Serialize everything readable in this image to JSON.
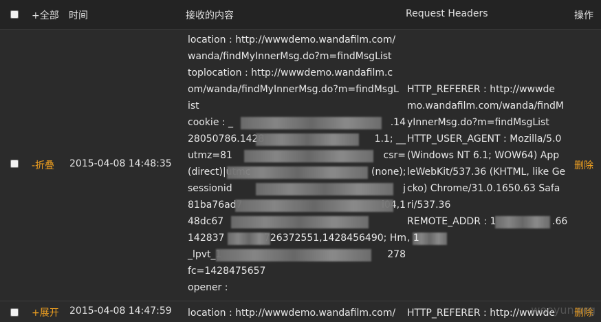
{
  "header": {
    "select_all_label": "+全部",
    "time_label": "时间",
    "content_label": "接收的内容",
    "headers_label": "Request Headers",
    "action_label": "操作"
  },
  "rows": [
    {
      "toggle": "-折叠",
      "time": "2015-04-08 14:48:35",
      "content_lines": [
        "location : http://wwwdemo.wandafilm.com/",
        "wanda/findMyInnerMsg.do?m=findMsgList",
        "toplocation : http://wwwdemo.wandafilm.c",
        "om/wanda/findMyInnerMsg.do?m=findMsgL",
        "ist",
        "cookie : _",
        "28050786.1428",
        "utmz=81",
        "(direct)|utmc",
        "sessionid",
        "81ba76ad7",
        "48dc67",
        "142837",
        "_lpvt_1",
        "fc=1428475657",
        "opener :"
      ],
      "content_tail": [
        ".14",
        "1.1; __",
        "csr=",
        "(none); j",
        "",
        "",
        "",
        "i04,1",
        "726372551,1428456490; Hm",
        "278"
      ],
      "headers_lines": [
        "HTTP_REFERER : http://wwwde",
        "mo.wandafilm.com/wanda/findM",
        "yInnerMsg.do?m=findMsgList",
        "HTTP_USER_AGENT : Mozilla/5.0",
        "(Windows NT 6.1; WOW64) App",
        "leWebKit/537.36 (KHTML, like Ge",
        "cko) Chrome/31.0.1650.63 Safa",
        "ri/537.36",
        "REMOTE_ADDR : 1",
        ", 1"
      ],
      "headers_tail": [
        ".66"
      ],
      "action": "删除"
    },
    {
      "toggle": "+展开",
      "time": "2015-04-08 14:47:59",
      "content_first": "location : http://wwwdemo.wandafilm.com/",
      "headers_first": "HTTP_REFERER : http://wwwde",
      "action": "删除"
    }
  ],
  "watermark": "wooyun.org",
  "colors": {
    "background": "#2b2b2b",
    "header_bg": "#232323",
    "accent": "#f0a020",
    "text": "#e6e6e6"
  }
}
